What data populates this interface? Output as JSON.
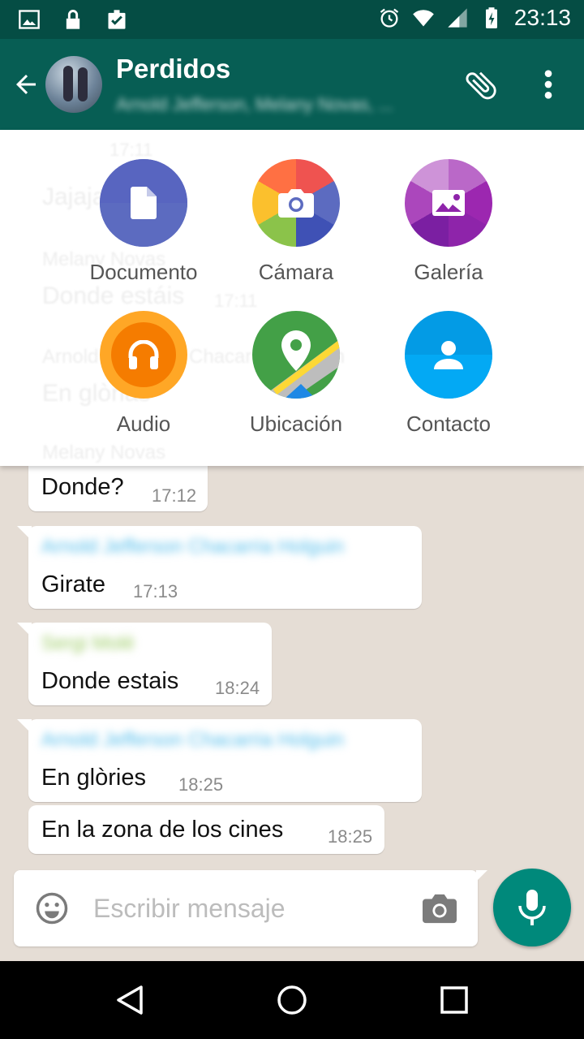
{
  "status_bar": {
    "time": "23:13",
    "left_icons": [
      "image-icon",
      "lock-icon",
      "clipboard-check-icon"
    ],
    "right_icons": [
      "alarm-icon",
      "wifi-icon",
      "signal-icon",
      "battery-charging-icon"
    ]
  },
  "header": {
    "title": "Perdidos",
    "subtitle": "Arnold Jefferson, Melany Novas, ..."
  },
  "attach_menu": {
    "options": [
      {
        "label": "Documento",
        "icon": "document-icon",
        "color": "#5c6bc0"
      },
      {
        "label": "Cámara",
        "icon": "camera-icon",
        "color": "#e53935"
      },
      {
        "label": "Galería",
        "icon": "gallery-icon",
        "color": "#ab47bc"
      },
      {
        "label": "Audio",
        "icon": "headphones-icon",
        "color": "#f57c00"
      },
      {
        "label": "Ubicación",
        "icon": "location-icon",
        "color": "#43a047"
      },
      {
        "label": "Contacto",
        "icon": "contact-icon",
        "color": "#039be5"
      }
    ],
    "hidden_behind": {
      "time1": "17:11",
      "msg1": "Jajaja",
      "sender1": "Melany Novas",
      "msg2": "Donde estáis",
      "time2": "17:11",
      "sender2": "Arnold Jefferson Chacarria Holguin",
      "msg3": "En glòrias",
      "sender3": "Melany Novas"
    }
  },
  "messages": [
    {
      "sender": "",
      "text": "Donde?",
      "time": "17:12"
    },
    {
      "sender": "Arnold Jefferson Chacarria Holguin",
      "text": "Girate",
      "time": "17:13"
    },
    {
      "sender": "Sergi Molé",
      "text": "Donde estais",
      "time": "18:24"
    },
    {
      "sender": "Arnold Jefferson Chacarria Holguin",
      "text": "En glòries",
      "time": "18:25"
    },
    {
      "sender": "",
      "text": "En la zona de los cines",
      "time": "18:25"
    }
  ],
  "composer": {
    "placeholder": "Escribir mensaje"
  },
  "colors": {
    "status_bar": "#054d44",
    "toolbar": "#075e54",
    "chat_bg": "#e5ddd5",
    "mic_button": "#00897b"
  }
}
